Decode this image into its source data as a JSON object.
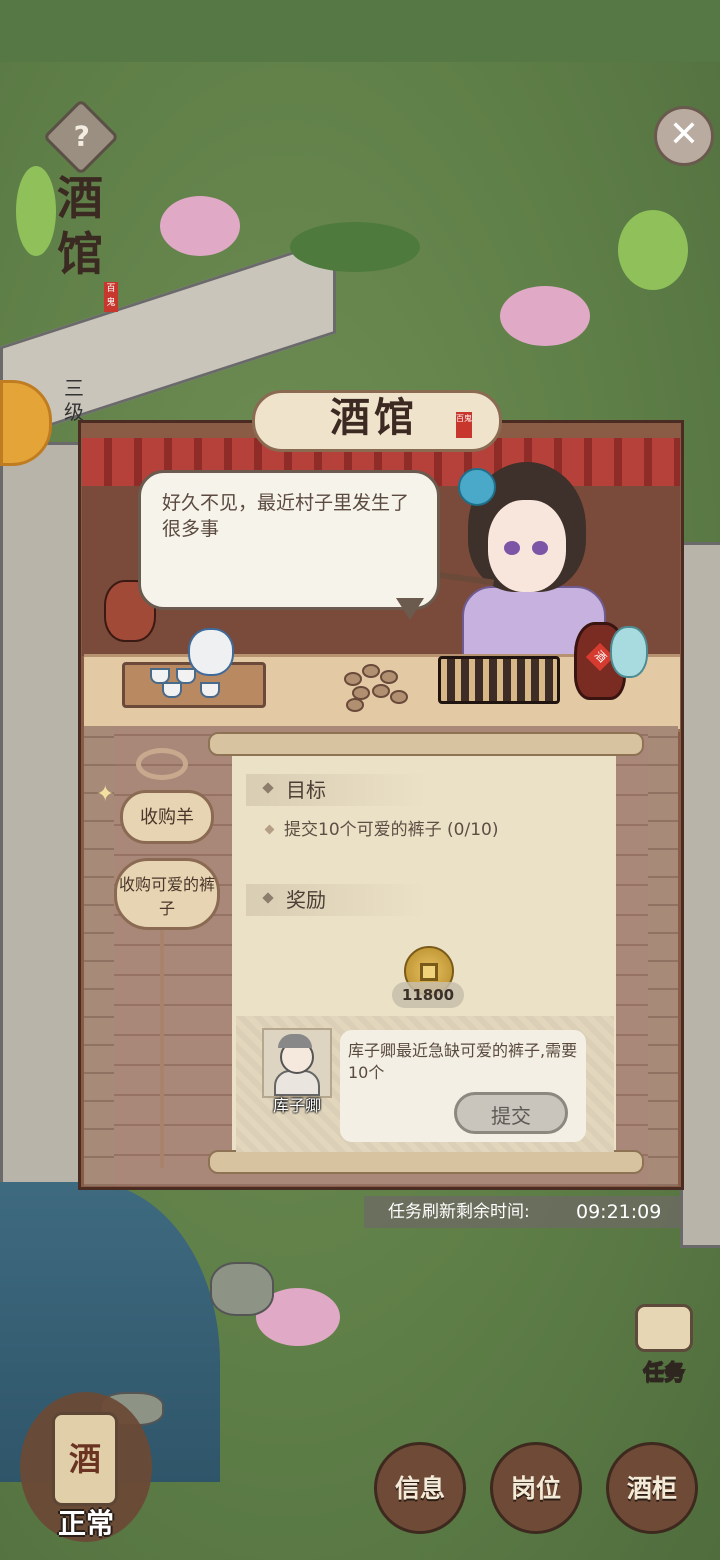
{
  "page": {
    "title_vertical": "酒馆",
    "title_seal": "百鬼",
    "level_text": "三级",
    "help_icon": "question-diamond-icon",
    "close_icon": "close-x-icon"
  },
  "tavern": {
    "sign_text": "酒馆",
    "sign_seal": "百鬼",
    "dialogue": "好久不见，最近村子里发生了很多事",
    "wine_jar_char": "酒"
  },
  "tasks": {
    "tabs": [
      {
        "label": "收购羊"
      },
      {
        "label": "收购可爱的裤子"
      }
    ]
  },
  "task_detail": {
    "goal_label": "目标",
    "goal_text": "提交10个可爱的裤子 (0/10)",
    "reward_label": "奖励",
    "reward_qty": "11800",
    "reward_icon": "copper-coin-icon",
    "npc_name": "库子卿",
    "npc_text": "库子卿最近急缺可爱的裤子,需要10个",
    "submit_label": "提交"
  },
  "refresh": {
    "label": "任务刷新剩余时间:",
    "time": "09:21:09"
  },
  "bottom": {
    "task_label": "任务",
    "status_label": "正常",
    "jar_char": "酒",
    "info_label": "信息",
    "post_label": "岗位",
    "cabinet_label": "酒柜"
  }
}
